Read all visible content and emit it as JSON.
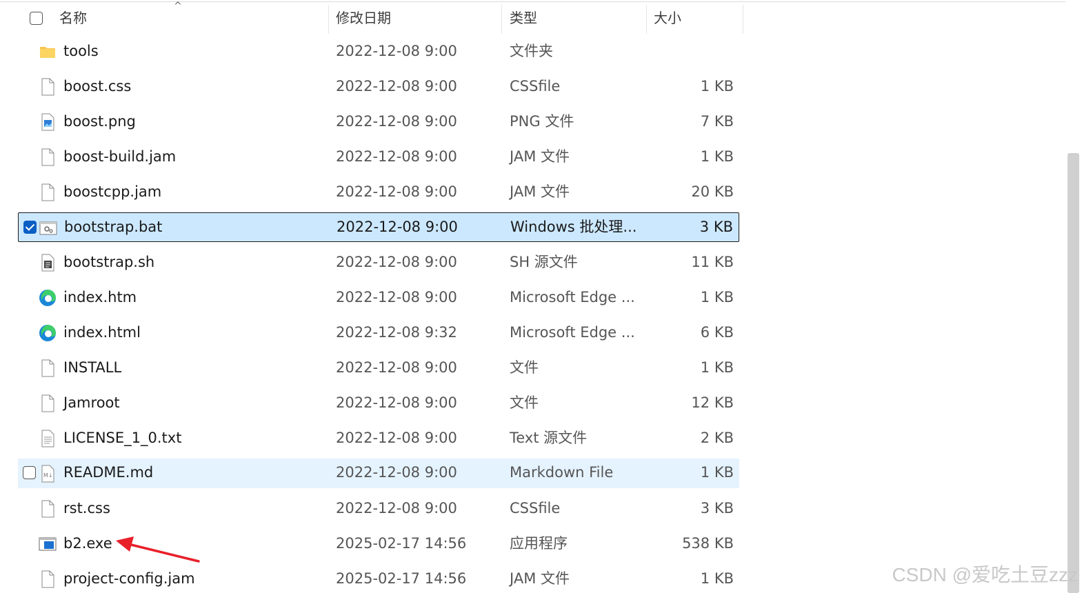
{
  "header": {
    "name": "名称",
    "date": "修改日期",
    "type": "类型",
    "size": "大小"
  },
  "files": [
    {
      "name": "tools",
      "date": "2022-12-08 9:00",
      "type": "文件夹",
      "size": "",
      "icon": "folder-icon"
    },
    {
      "name": "boost.css",
      "date": "2022-12-08 9:00",
      "type": "CSSfile",
      "size": "1 KB",
      "icon": "file-icon"
    },
    {
      "name": "boost.png",
      "date": "2022-12-08 9:00",
      "type": "PNG 文件",
      "size": "7 KB",
      "icon": "image-file-icon"
    },
    {
      "name": "boost-build.jam",
      "date": "2022-12-08 9:00",
      "type": "JAM 文件",
      "size": "1 KB",
      "icon": "file-icon"
    },
    {
      "name": "boostcpp.jam",
      "date": "2022-12-08 9:00",
      "type": "JAM 文件",
      "size": "20 KB",
      "icon": "file-icon"
    },
    {
      "name": "bootstrap.bat",
      "date": "2022-12-08 9:00",
      "type": "Windows 批处理...",
      "size": "3 KB",
      "icon": "batch-file-icon",
      "state": "selected"
    },
    {
      "name": "bootstrap.sh",
      "date": "2022-12-08 9:00",
      "type": "SH 源文件",
      "size": "11 KB",
      "icon": "script-file-icon"
    },
    {
      "name": "index.htm",
      "date": "2022-12-08 9:00",
      "type": "Microsoft Edge ...",
      "size": "1 KB",
      "icon": "edge-icon"
    },
    {
      "name": "index.html",
      "date": "2022-12-08 9:32",
      "type": "Microsoft Edge ...",
      "size": "6 KB",
      "icon": "edge-icon"
    },
    {
      "name": "INSTALL",
      "date": "2022-12-08 9:00",
      "type": "文件",
      "size": "1 KB",
      "icon": "file-icon"
    },
    {
      "name": "Jamroot",
      "date": "2022-12-08 9:00",
      "type": "文件",
      "size": "12 KB",
      "icon": "file-icon"
    },
    {
      "name": "LICENSE_1_0.txt",
      "date": "2022-12-08 9:00",
      "type": "Text 源文件",
      "size": "2 KB",
      "icon": "text-file-icon"
    },
    {
      "name": "README.md",
      "date": "2022-12-08 9:00",
      "type": "Markdown File",
      "size": "1 KB",
      "icon": "markdown-file-icon",
      "state": "hover"
    },
    {
      "name": "rst.css",
      "date": "2022-12-08 9:00",
      "type": "CSSfile",
      "size": "3 KB",
      "icon": "file-icon"
    },
    {
      "name": "b2.exe",
      "date": "2025-02-17 14:56",
      "type": "应用程序",
      "size": "538 KB",
      "icon": "exe-file-icon"
    },
    {
      "name": "project-config.jam",
      "date": "2025-02-17 14:56",
      "type": "JAM 文件",
      "size": "1 KB",
      "icon": "file-icon"
    }
  ],
  "watermark": "CSDN @爱吃土豆zzz",
  "colors": {
    "selected_bg": "#cce8ff",
    "hover_bg": "#e5f3ff",
    "checkbox_checked": "#0a5fc4",
    "folder": "#f8c44c",
    "annotation_arrow": "#e8202a"
  }
}
